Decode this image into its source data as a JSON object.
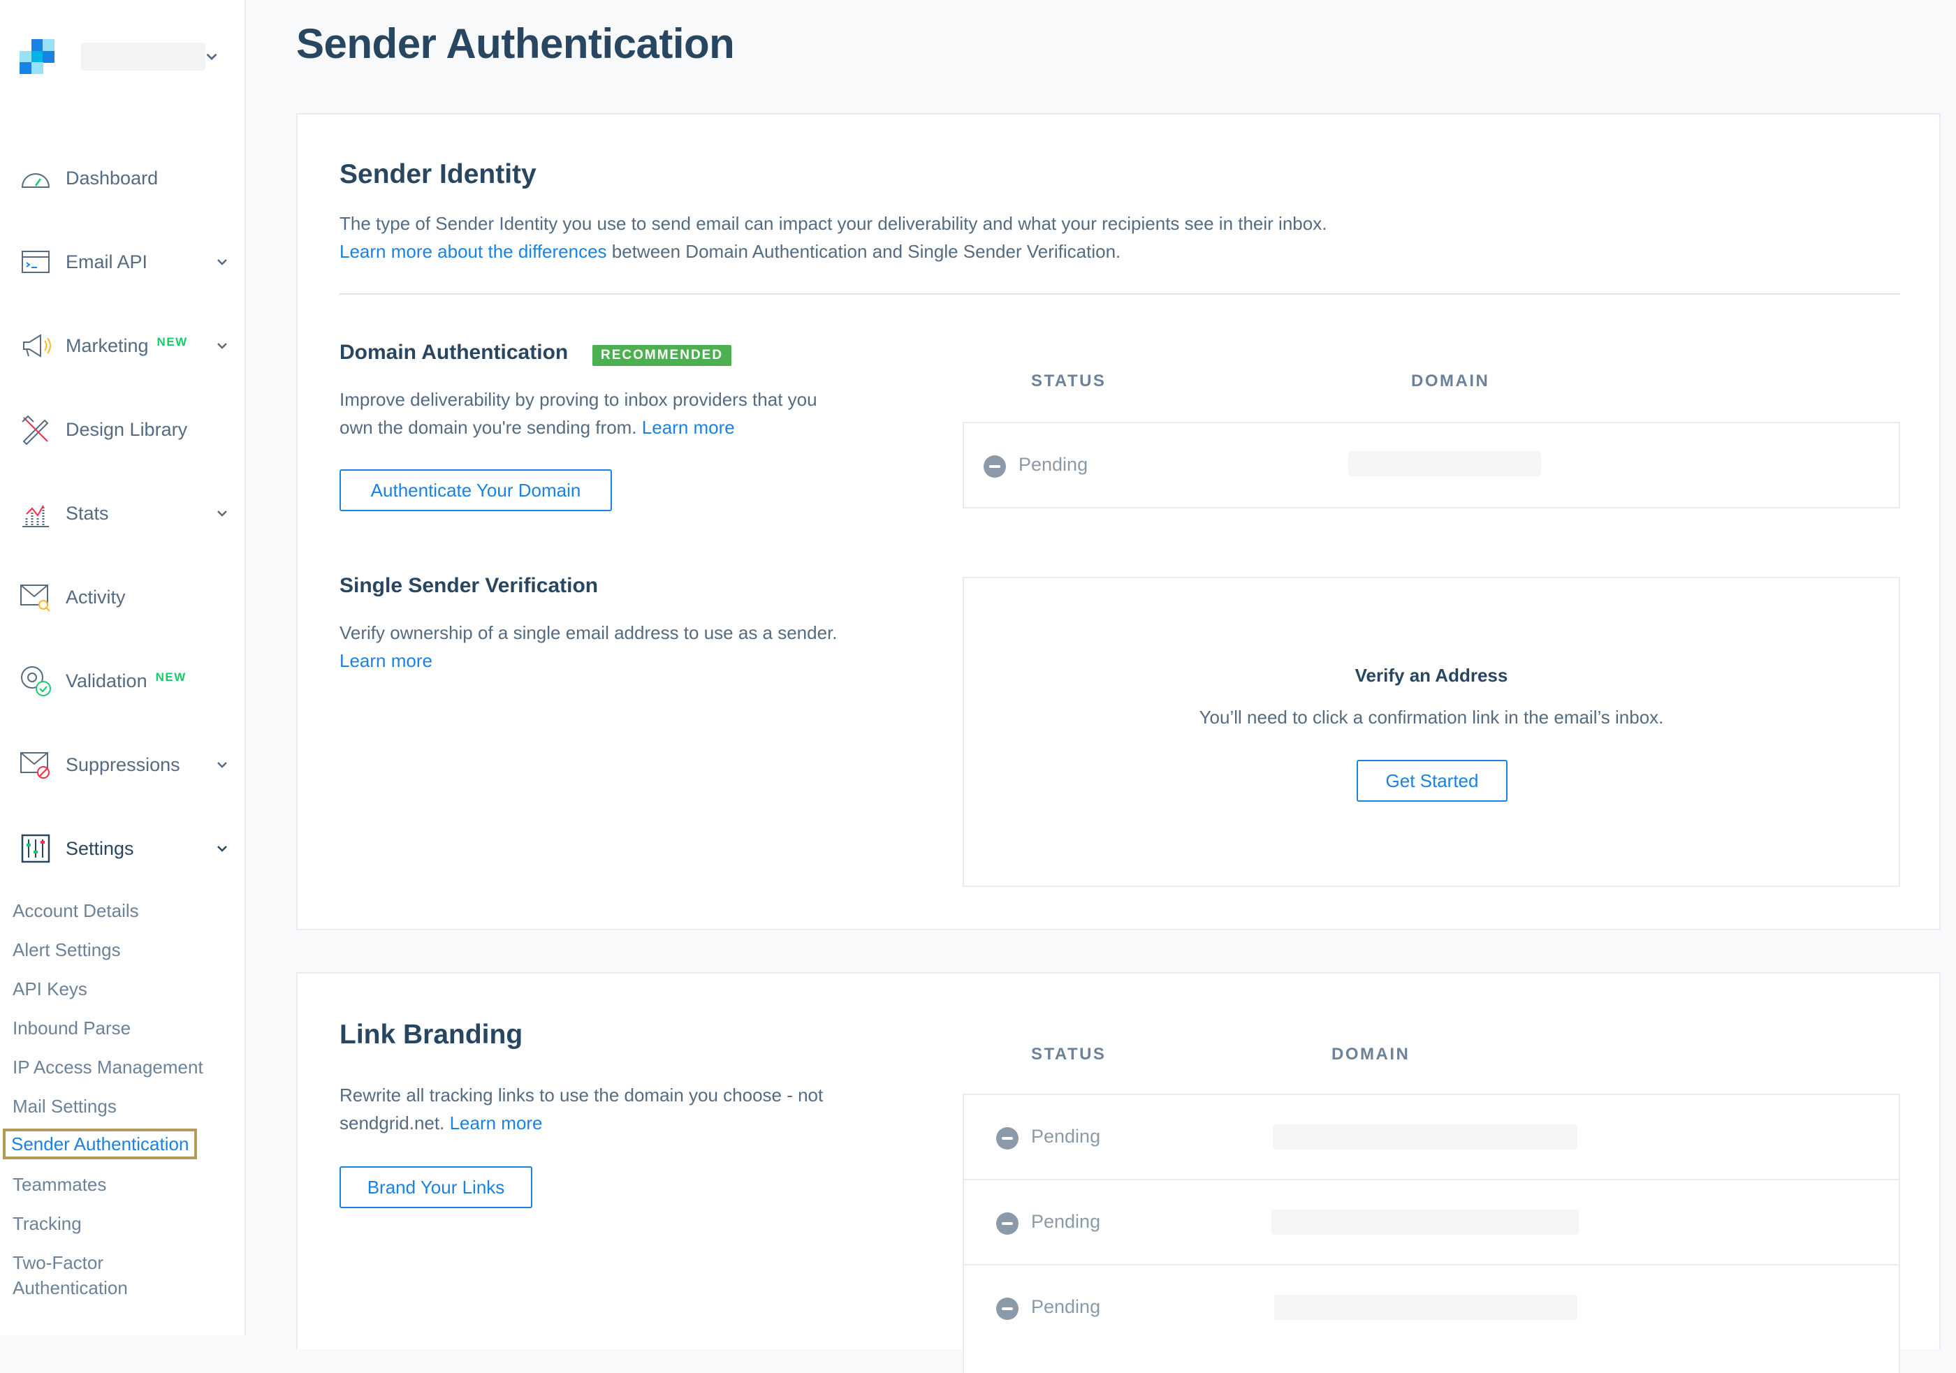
{
  "sidebar": {
    "nav": [
      {
        "label": "Dashboard",
        "icon": "dashboard-gauge-icon",
        "new": "",
        "chevron": false
      },
      {
        "label": "Email API",
        "icon": "email-api-icon",
        "new": "",
        "chevron": true
      },
      {
        "label": "Marketing",
        "icon": "megaphone-icon",
        "new": "NEW",
        "chevron": true
      },
      {
        "label": "Design Library",
        "icon": "design-library-icon",
        "new": "",
        "chevron": false
      },
      {
        "label": "Stats",
        "icon": "stats-chart-icon",
        "new": "",
        "chevron": true
      },
      {
        "label": "Activity",
        "icon": "activity-envelope-icon",
        "new": "",
        "chevron": false
      },
      {
        "label": "Validation",
        "icon": "validation-at-icon",
        "new": "NEW",
        "chevron": false
      },
      {
        "label": "Suppressions",
        "icon": "suppressions-envelope-icon",
        "new": "",
        "chevron": true
      },
      {
        "label": "Settings",
        "icon": "settings-sliders-icon",
        "new": "",
        "chevron": true
      }
    ],
    "settings_sub": [
      "Account Details",
      "Alert Settings",
      "API Keys",
      "Inbound Parse",
      "IP Access Management",
      "Mail Settings",
      "Sender Authentication",
      "Teammates",
      "Tracking",
      "Two-Factor Authentication"
    ]
  },
  "page_title": "Sender Authentication",
  "sender_identity": {
    "title": "Sender Identity",
    "desc": "The type of Sender Identity you use to send email can impact your deliverability and what your recipients see in their inbox.",
    "learn_link": "Learn more about the differences",
    "learn_rest": " between Domain Authentication and Single Sender Verification."
  },
  "domain_auth": {
    "title": "Domain Authentication",
    "badge": "RECOMMENDED",
    "desc_1": "Improve deliverability by proving to inbox providers that you",
    "desc_2": "own the domain you're sending from.",
    "learn": "Learn more",
    "button": "Authenticate Your Domain",
    "col_status": "STATUS",
    "col_domain": "DOMAIN",
    "row_status": "Pending"
  },
  "single_sender": {
    "title": "Single Sender Verification",
    "desc": "Verify ownership of a single email address to use as a sender.",
    "learn": "Learn more",
    "verify_title": "Verify an Address",
    "verify_desc": "You’ll need to click a confirmation link in the email’s inbox.",
    "button": "Get Started"
  },
  "link_branding": {
    "title": "Link Branding",
    "desc_1": "Rewrite all tracking links to use the domain you choose - not",
    "desc_2": "sendgrid.net.",
    "learn": "Learn more",
    "button": "Brand Your Links",
    "col_status": "STATUS",
    "col_domain": "DOMAIN",
    "rows": [
      "Pending",
      "Pending",
      "Pending"
    ]
  }
}
